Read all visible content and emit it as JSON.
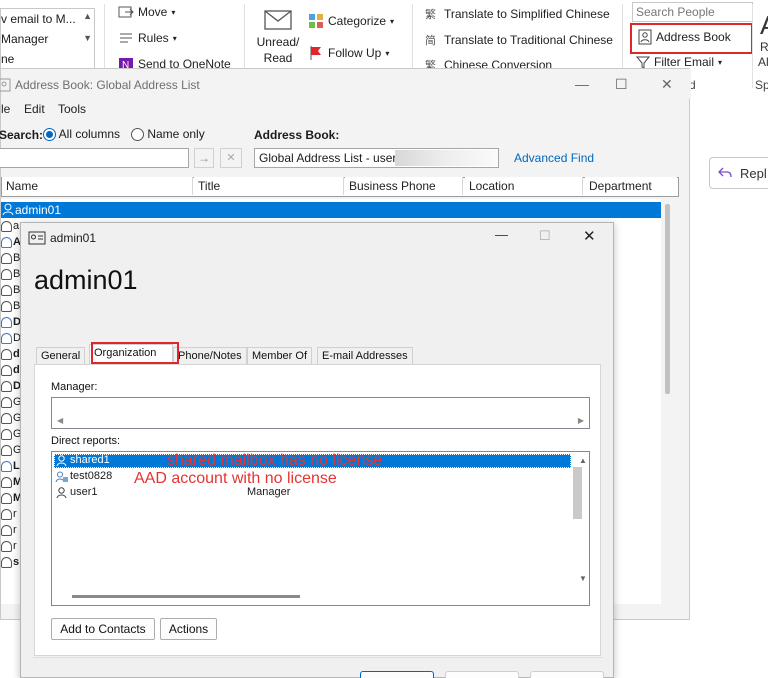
{
  "ribbon": {
    "quick_steps": [
      "v email to M...",
      "Manager",
      "ne"
    ],
    "move": "Move",
    "rules": "Rules",
    "send_onenote": "Send to OneNote",
    "unread_read": "Unread/ Read",
    "categorize": "Categorize",
    "follow_up": "Follow Up",
    "translate_simplified": "Translate to Simplified Chinese",
    "translate_traditional": "Translate to Traditional Chinese",
    "chinese_conversion": "Chinese Conversion",
    "search_people_placeholder": "Search People",
    "address_book": "Address Book",
    "filter_email": "Filter Email",
    "group_label_d": "d",
    "group_label_sp": "Sp",
    "right_cut_a": "A",
    "right_cut_r": "R",
    "right_cut_al": "Al"
  },
  "reading_pane": {
    "reply": "Repl"
  },
  "address_book": {
    "title": "Address Book: Global Address List",
    "menu": [
      "le",
      "Edit",
      "Tools"
    ],
    "search_label": "Search:",
    "all_columns": "All columns",
    "name_only": "Name only",
    "address_book_label": "Address Book:",
    "address_book_value": "Global Address List - user1",
    "advanced_find": "Advanced Find",
    "go_arrow": "→",
    "clear_x": "✕",
    "columns": [
      "Name",
      "Title",
      "Business Phone",
      "Location",
      "Department"
    ],
    "rows": [
      "admin01",
      "a",
      "A",
      "B",
      "B",
      "B",
      "B",
      "D",
      "D",
      "d",
      "d",
      "D",
      "G",
      "G",
      "G",
      "G",
      "L",
      "M",
      "M",
      "r",
      "r",
      "r",
      "s"
    ]
  },
  "properties": {
    "window_title": "admin01",
    "display_name": "admin01",
    "tabs": [
      "General",
      "Organization",
      "Phone/Notes",
      "Member Of",
      "E-mail Addresses"
    ],
    "manager_label": "Manager:",
    "direct_reports_label": "Direct reports:",
    "direct_reports": [
      {
        "name": "shared1",
        "title": ""
      },
      {
        "name": "test0828",
        "title": ""
      },
      {
        "name": "user1",
        "title": "Manager"
      }
    ],
    "annotation_shared": "shared mailbox has no license",
    "annotation_aad": "AAD account with no license",
    "add_to_contacts": "Add to Contacts",
    "actions": "Actions"
  },
  "colors": {
    "selection": "#0078d7",
    "annotation": "#e0262b",
    "link": "#0067c0"
  }
}
